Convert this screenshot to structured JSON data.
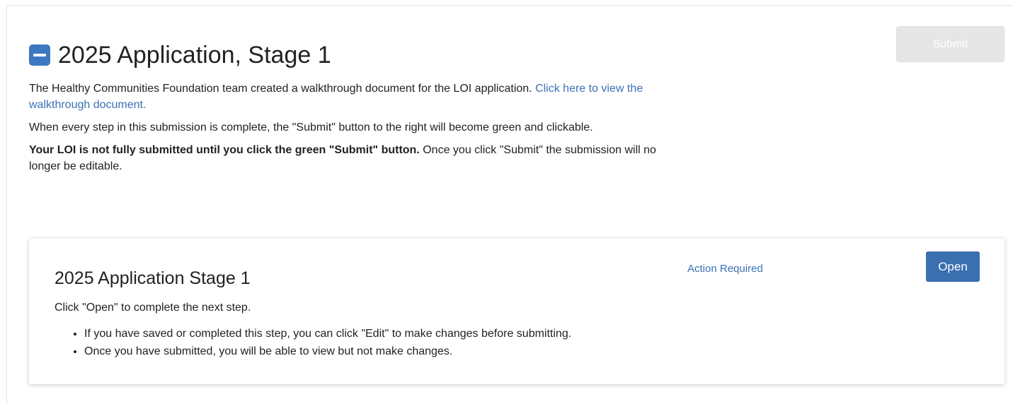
{
  "header": {
    "title": "2025 Application, Stage 1",
    "submit_label": "Submit"
  },
  "intro": {
    "p1_text": "The Healthy Communities Foundation team created a walkthrough document for the LOI application. ",
    "p1_link": "Click here to view the walkthrough document.",
    "p2_text": "When every step in this submission is complete, the \"Submit\" button to the right will become green and clickable.",
    "p3_bold": "Your LOI is not fully submitted until you click the green \"Submit\" button.",
    "p3_text": " Once you click \"Submit\" the submission will no longer be editable."
  },
  "step": {
    "title": "2025 Application Stage 1",
    "status": "Action Required",
    "open_label": "Open",
    "description": "Click \"Open\" to complete the next step.",
    "bullets": [
      "If you have saved or completed this step, you can click \"Edit\" to make changes before submitting.",
      "Once you have submitted, you will be able to view but not make changes."
    ]
  },
  "colors": {
    "accent": "#3a6fb0",
    "submit_disabled": "#e6e6e6"
  },
  "icons": {
    "collapse": "minus-square-icon"
  }
}
